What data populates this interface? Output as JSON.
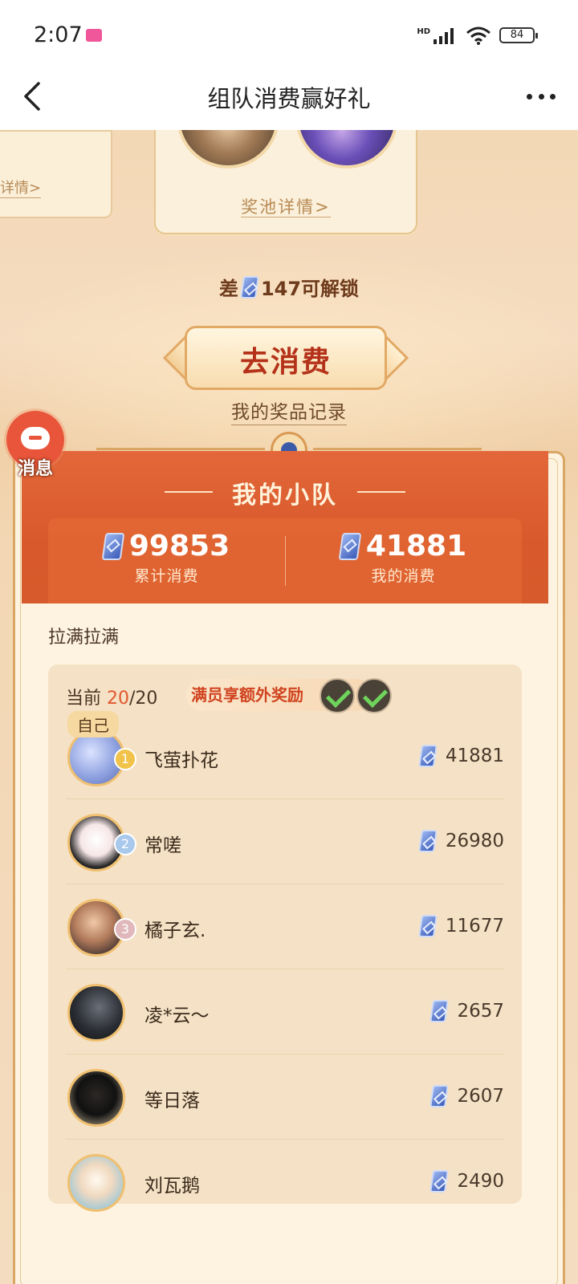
{
  "status_bar": {
    "time": "2:07",
    "network": "HD",
    "battery": "84"
  },
  "nav": {
    "title": "组队消费赢好礼"
  },
  "top": {
    "left_card_link": "详情>",
    "pool_link": "奖池详情>",
    "unlock_prefix": "差",
    "unlock_suffix": "147可解锁",
    "go_button": "去消费",
    "record_link": "我的奖品记录",
    "message_label": "消息"
  },
  "team": {
    "title": "我的小队",
    "total_spend": {
      "value": "99853",
      "label": "累计消费"
    },
    "my_spend": {
      "value": "41881",
      "label": "我的消费"
    },
    "team_name": "拉满拉满",
    "count_prefix": "当前",
    "count_current": "20",
    "count_total": "/20",
    "full_bonus_label": "满员享额外奖励",
    "self_tag": "自己",
    "members": [
      {
        "rank": "1",
        "name": "飞萤扑花",
        "amount": "41881"
      },
      {
        "rank": "2",
        "name": "常嗟",
        "amount": "26980"
      },
      {
        "rank": "3",
        "name": "橘子玄.",
        "amount": "11677"
      },
      {
        "rank": "",
        "name": "凌*云～",
        "amount": "2657"
      },
      {
        "rank": "",
        "name": "等日落",
        "amount": "2607"
      },
      {
        "rank": "",
        "name": "刘瓦鹅",
        "amount": "2490"
      }
    ]
  },
  "colors": {
    "accent": "#d85a2c",
    "highlight": "#e2572e",
    "button_text": "#b5321a"
  }
}
